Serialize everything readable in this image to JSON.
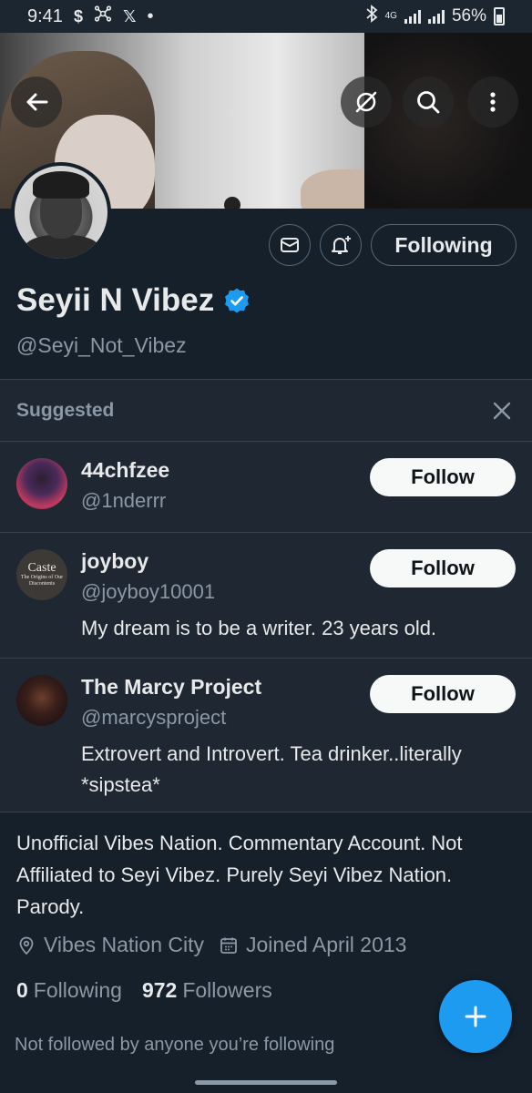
{
  "status_bar": {
    "time": "9:41",
    "icons": [
      "dollar-icon",
      "network-icon",
      "x-logo-icon",
      "dot-icon"
    ],
    "dollar_glyph": "$",
    "x_glyph": "𝕏",
    "dot_glyph": "•",
    "network_label": "4G",
    "battery": "56%"
  },
  "banner": {
    "buttons": [
      "back-arrow-icon",
      "grok-icon",
      "search-icon",
      "more-vertical-icon"
    ]
  },
  "profile": {
    "name": "Seyii N Vibez",
    "handle": "@Seyi_Not_Vibez",
    "following_button": "Following",
    "verified_color": "#1d9bf0",
    "bio": "Unofficial Vibes Nation. Commentary Account. Not Affiliated to Seyi Vibez. Purely Seyi Vibez Nation. Parody.",
    "location": "Vibes Nation City",
    "joined": "Joined April 2013",
    "following_count": "0",
    "following_label": "Following",
    "followers_count": "972",
    "followers_label": "Followers",
    "not_followed_text": "Not followed by anyone you’re following"
  },
  "suggested": {
    "title": "Suggested",
    "items": [
      {
        "name": "44chfzee",
        "handle": "@1nderrr",
        "bio": "",
        "button": "Follow"
      },
      {
        "name": "joyboy",
        "handle": "@joyboy10001",
        "bio": "My dream is to be a writer. 23 years old.",
        "button": "Follow",
        "avatar_text_1": "Caste",
        "avatar_text_2": "The Origins of Our Discontents"
      },
      {
        "name": "The Marcy Project",
        "handle": "@marcysproject",
        "bio": "Extrovert and Introvert. Tea drinker..literally *sipstea*",
        "button": "Follow"
      }
    ]
  },
  "colors": {
    "background": "#15202b",
    "accent": "#1d9bf0",
    "muted_text": "#8b98a5"
  }
}
